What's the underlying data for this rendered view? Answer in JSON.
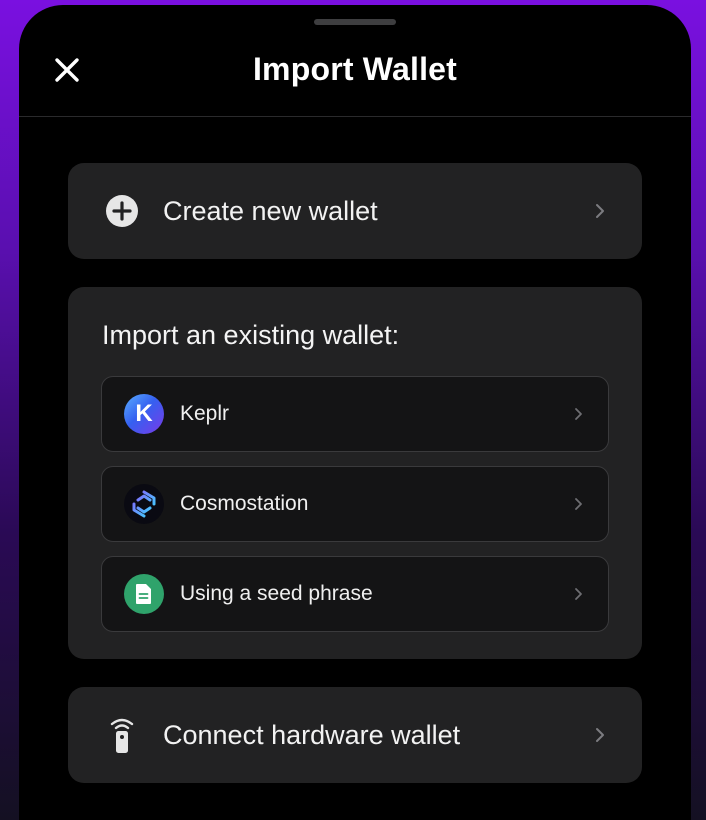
{
  "header": {
    "title": "Import Wallet"
  },
  "create": {
    "label": "Create new wallet"
  },
  "import_section": {
    "heading": "Import an existing wallet:",
    "options": [
      {
        "label": "Keplr",
        "icon_letter": "K",
        "icon": "keplr-logo-icon"
      },
      {
        "label": "Cosmostation",
        "icon": "cosmostation-logo-icon"
      },
      {
        "label": "Using a seed phrase",
        "icon": "document-icon"
      }
    ]
  },
  "hardware": {
    "label": "Connect hardware wallet"
  },
  "colors": {
    "sheet_bg": "#000000",
    "card_bg": "#222223",
    "option_bg": "#141415",
    "seed_green": "#2fa36b",
    "background_purple": "#7a10e0"
  }
}
